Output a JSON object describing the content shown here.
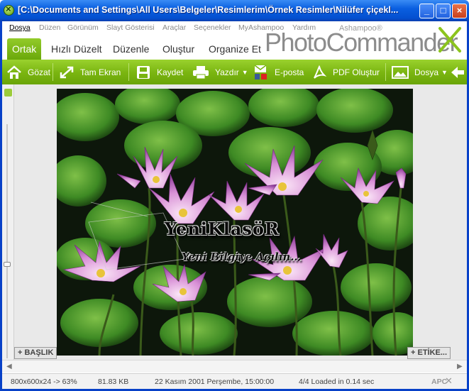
{
  "window": {
    "title": "[C:\\Documents and Settings\\All Users\\Belgeler\\Resimlerim\\Örnek Resimler\\Nilüfer çiçekl...",
    "minimize": "_",
    "maximize": "□",
    "close": "×"
  },
  "menu": [
    "Dosya",
    "Düzen",
    "Görünüm",
    "Slayt Gösterisi",
    "Araçlar",
    "Seçenekler",
    "MyAshampoo",
    "Yardım"
  ],
  "brand": {
    "company": "Ashampoo®",
    "product": "PhotoCommander"
  },
  "tabs": [
    "Ortak",
    "Hızlı Düzelt",
    "Düzenle",
    "Oluştur",
    "Organize Et"
  ],
  "toolbar": {
    "view": "Gözat",
    "fullscreen": "Tam Ekran",
    "save": "Kaydet",
    "print": "Yazdır",
    "email": "E-posta",
    "pdf": "PDF Oluştur",
    "file": "Dosya"
  },
  "image": {
    "watermark_title": "YeniKlasöR",
    "watermark_subtitle": "Yeni Bilgiye Açılın..."
  },
  "tags": {
    "title": "+ BAŞLIK",
    "label": "+ ETİKE..."
  },
  "status": {
    "dimensions": "800x600x24 -> 63%",
    "size": "81.83 KB",
    "date": "22 Kasım 2001 Perşembe, 15:00:00",
    "load": "4/4  Loaded in 0.14 sec",
    "logo": "APC"
  },
  "colors": {
    "accent": "#7cb814",
    "titlebar": "#0a5fe0"
  }
}
